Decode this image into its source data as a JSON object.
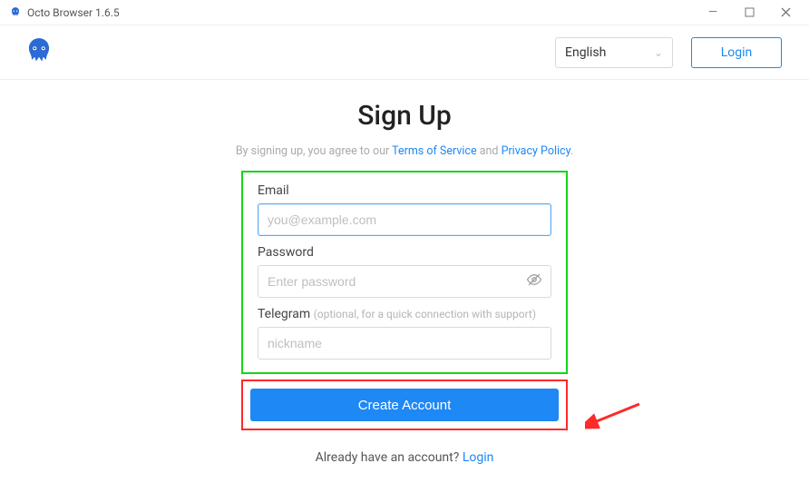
{
  "window": {
    "title": "Octo Browser 1.6.5"
  },
  "header": {
    "language_selected": "English",
    "login_label": "Login"
  },
  "signup": {
    "heading": "Sign Up",
    "terms_prefix": "By signing up, you agree to our ",
    "terms_link": "Terms of Service",
    "terms_and": " and ",
    "privacy_link": "Privacy Policy",
    "terms_suffix": "."
  },
  "form": {
    "email_label": "Email",
    "email_placeholder": "you@example.com",
    "email_value": "",
    "password_label": "Password",
    "password_placeholder": "Enter password",
    "password_value": "",
    "telegram_label": "Telegram",
    "telegram_hint": "(optional, for a quick connection with support)",
    "telegram_placeholder": "nickname",
    "telegram_value": ""
  },
  "submit": {
    "create_label": "Create Account"
  },
  "footer": {
    "already_text": "Already have an account? ",
    "login_link": "Login"
  },
  "colors": {
    "accent": "#1e88f5",
    "annotation_green": "#17d417",
    "annotation_red": "#ff2a2a"
  }
}
